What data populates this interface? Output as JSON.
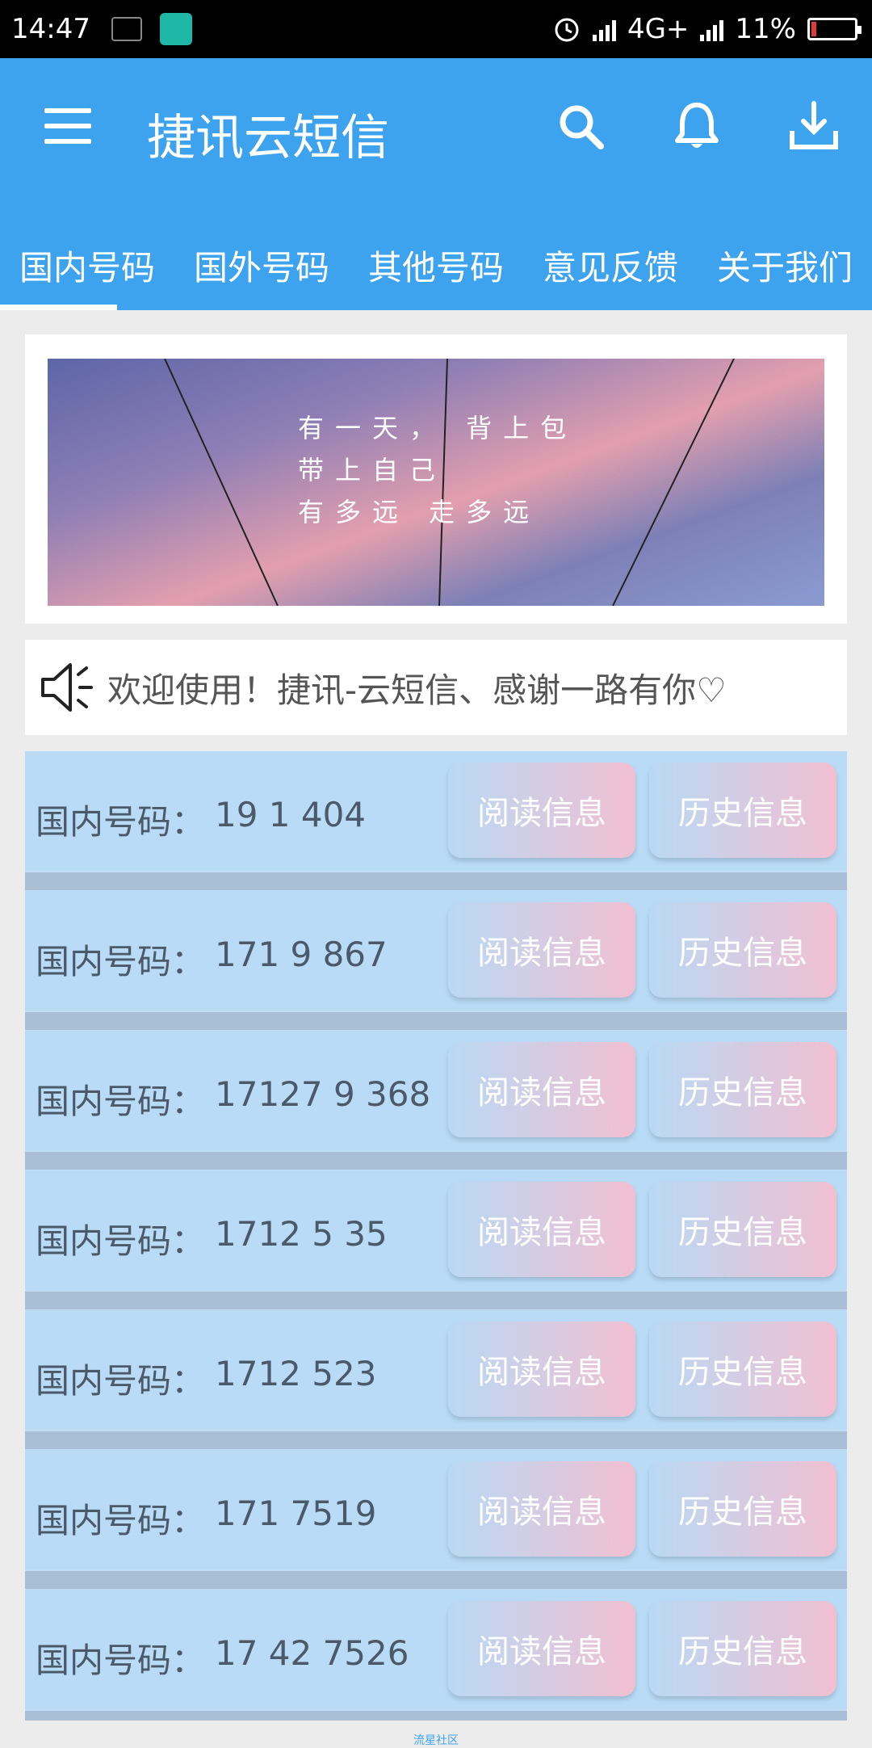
{
  "status_bar": {
    "time": "14:47",
    "network": "4G+",
    "battery": "11%",
    "battery_level": 0.11
  },
  "app_bar": {
    "title": "捷讯云短信"
  },
  "tabs": [
    "国内号码",
    "国外号码",
    "其他号码",
    "意见反馈",
    "关于我们"
  ],
  "banner": {
    "lines": [
      "有一天， 背上包",
      "带上自己",
      "有多远 走多远"
    ]
  },
  "notice": {
    "text": "欢迎使用！捷讯-云短信、感谢一路有你♡"
  },
  "numbers": [
    {
      "label": "国内号码：",
      "number": "19  1  404",
      "read": "阅读信息",
      "history": "历史信息"
    },
    {
      "label": "国内号码：",
      "number": "171  9  867",
      "read": "阅读信息",
      "history": "历史信息"
    },
    {
      "label": "国内号码：",
      "number": "17127  9  368",
      "read": "阅读信息",
      "history": "历史信息"
    },
    {
      "label": "国内号码：",
      "number": "1712  5  35",
      "read": "阅读信息",
      "history": "历史信息"
    },
    {
      "label": "国内号码：",
      "number": "1712    523",
      "read": "阅读信息",
      "history": "历史信息"
    },
    {
      "label": "国内号码：",
      "number": "171    7519",
      "read": "阅读信息",
      "history": "历史信息"
    },
    {
      "label": "国内号码：",
      "number": "17  42  7526",
      "read": "阅读信息",
      "history": "历史信息"
    }
  ],
  "watermark": "流星社区"
}
